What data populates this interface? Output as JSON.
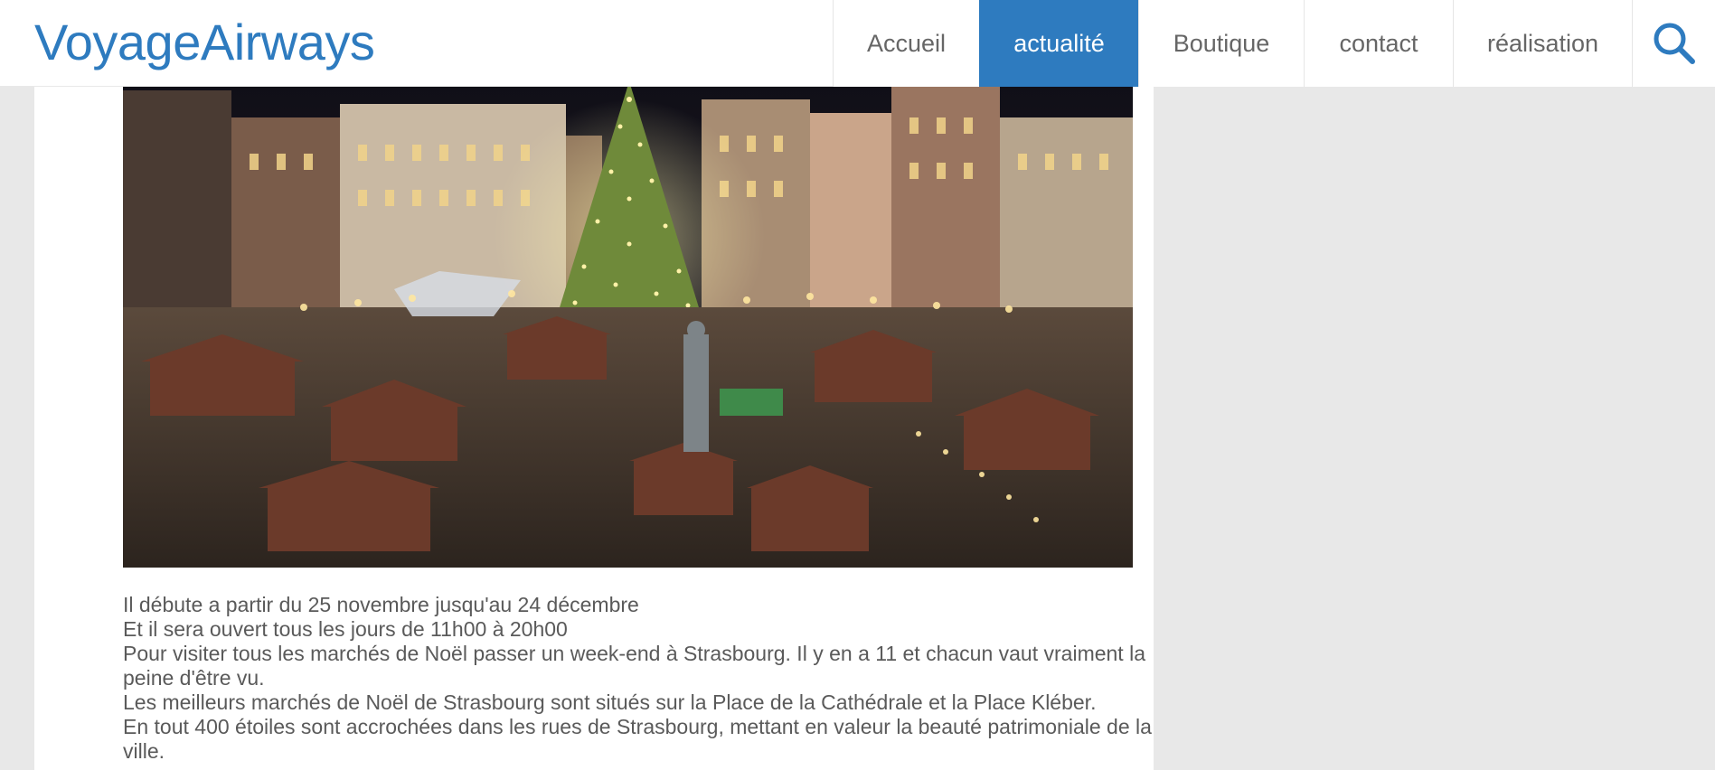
{
  "header": {
    "logo": "VoyageAirways",
    "nav": [
      {
        "label": "Accueil",
        "active": false
      },
      {
        "label": "actualité",
        "active": true
      },
      {
        "label": "Boutique",
        "active": false
      },
      {
        "label": "contact",
        "active": false
      },
      {
        "label": "réalisation",
        "active": false
      }
    ],
    "search_icon": "search-icon"
  },
  "article": {
    "lines": [
      "Il débute a partir du 25 novembre jusqu'au 24 décembre",
      "Et il sera ouvert tous les jours de 11h00 à 20h00",
      "Pour visiter tous les marchés de Noël passer un week-end à Strasbourg. Il y en a 11 et chacun vaut vraiment la peine d'être vu.",
      "Les meilleurs marchés de Noël de Strasbourg sont situés sur la Place de la Cathédrale et la Place Kléber.",
      "En tout 400 étoiles sont accrochées dans les rues de Strasbourg, mettant en valeur la beauté patrimoniale de la ville."
    ]
  },
  "colors": {
    "accent": "#2e7bbf",
    "page_bg": "#e8e8e8",
    "text": "#5a5a5a"
  }
}
